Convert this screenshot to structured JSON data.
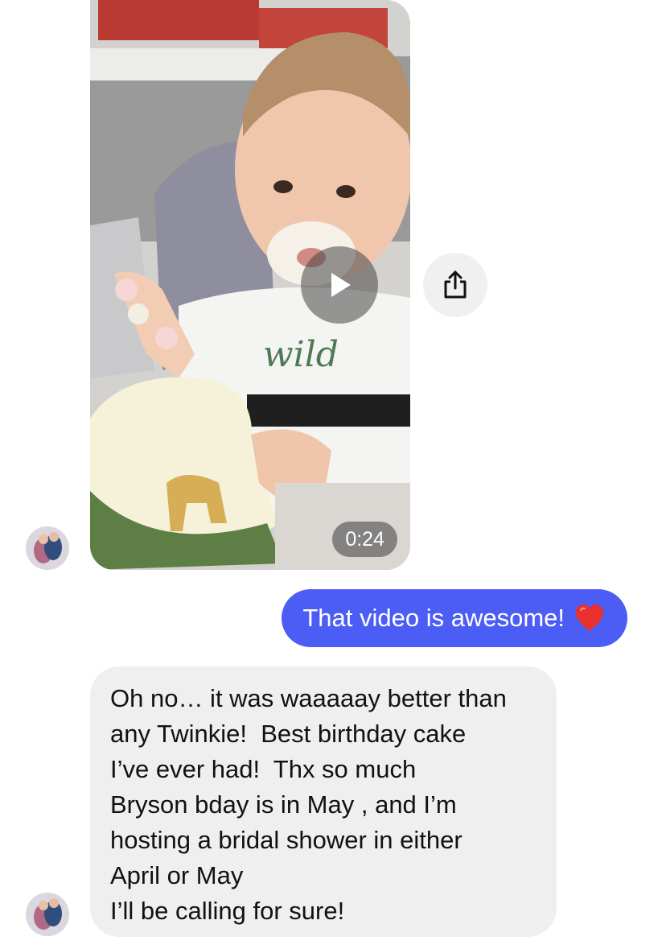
{
  "video_message": {
    "duration": "0:24",
    "play_icon": "play-icon",
    "share_icon": "share-icon"
  },
  "outgoing_message": {
    "text": "That video is awesome!",
    "emoji": "❤️"
  },
  "incoming_message": {
    "lines": [
      "Oh no… it was waaaaay better than",
      "any Twinkie!  Best birthday cake",
      "I’ve ever had!  Thx so much",
      "Bryson bday is in May , and I’m",
      "hosting a bridal shower in either",
      "April or May",
      "I’ll be calling for sure!"
    ]
  },
  "colors": {
    "outgoing_bubble": "#4c5df5",
    "incoming_bubble": "#efefef",
    "share_button_bg": "#f0f0f0"
  }
}
